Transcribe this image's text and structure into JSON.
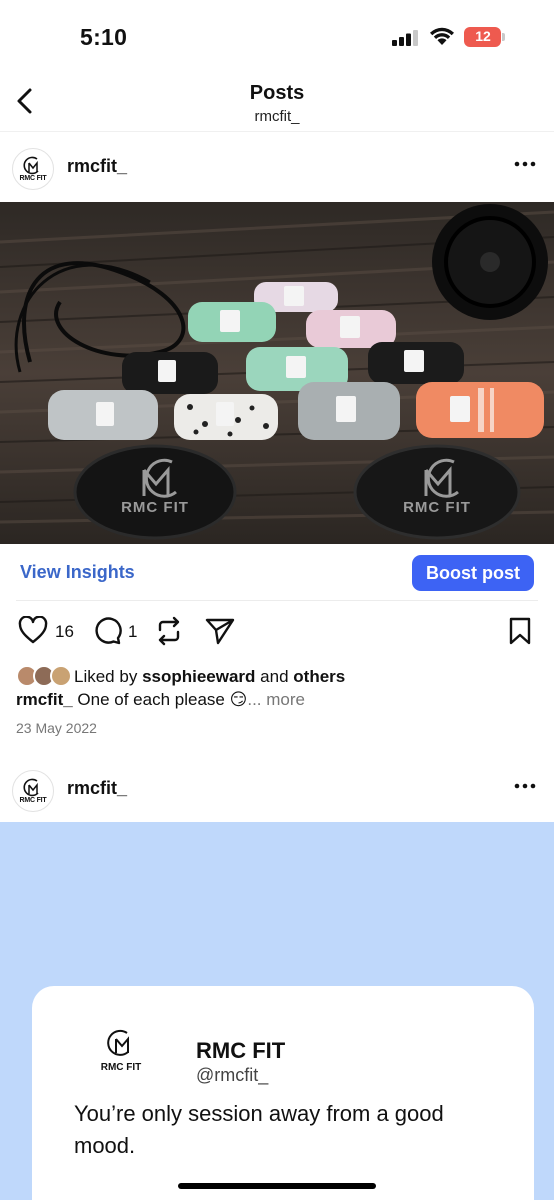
{
  "status": {
    "time": "5:10",
    "battery": "12"
  },
  "nav": {
    "title": "Posts",
    "subtitle": "rmcfit_"
  },
  "post1": {
    "username": "rmcfit_",
    "avatar_text": "RMC FIT",
    "photo_logo_text": "RMC FIT",
    "view_insights": "View Insights",
    "boost_post": "Boost post",
    "likes_count": "16",
    "comments_count": "1",
    "liked_by_prefix": "Liked by",
    "liked_by_user": "ssophieeward",
    "liked_by_and": "and",
    "liked_by_others": "others",
    "caption_user": "rmcfit_",
    "caption_text": "One of each please",
    "caption_emoji": "😏",
    "caption_more": "... more",
    "date": "23 May 2022"
  },
  "post2": {
    "username": "rmcfit_",
    "avatar_text": "RMC FIT",
    "card": {
      "logo_text": "RMC FIT",
      "name": "RMC FIT",
      "handle": "@rmcfit_",
      "quote": "You’re only session away from a good mood."
    }
  },
  "icons": [
    "signal-icon",
    "wifi-icon",
    "battery-icon",
    "back-arrow-icon",
    "more-icon",
    "heart-icon",
    "comment-icon",
    "repost-icon",
    "send-icon",
    "bookmark-icon"
  ],
  "colors": {
    "accent": "#3d63f4",
    "insights": "#3b67c9",
    "card_bg": "#bfd8fb",
    "battery": "#ee5a4f"
  }
}
